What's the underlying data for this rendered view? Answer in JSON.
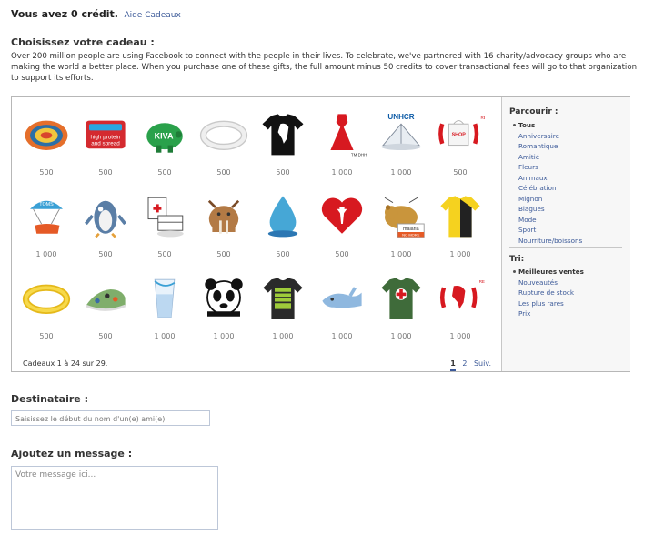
{
  "header": {
    "credits_text": "Vous avez 0 crédit.",
    "help_link": "Aide Cadeaux"
  },
  "choose": {
    "title": "Choisissez votre cadeau :",
    "intro": "Over 200 million people are using Facebook to connect with the people in their lives. To celebrate, we've partnered with 16 charity/advocacy groups who are making the world a better place. When you purchase one of these gifts, the full amount minus 50 credits to cover transactional fees will go to that organization to support its efforts."
  },
  "gifts": [
    {
      "name": "woven-disc-gift",
      "price": "500"
    },
    {
      "name": "unicef-sign-gift",
      "price": "500",
      "text": "high protein\nand spread"
    },
    {
      "name": "kiva-piggy-bank-gift",
      "price": "500",
      "text": "KIVA"
    },
    {
      "name": "white-bracelet-gift",
      "price": "500"
    },
    {
      "name": "africa-tshirt-gift",
      "price": "500"
    },
    {
      "name": "red-dress-gift",
      "price": "1 000",
      "text": "TM DHHS"
    },
    {
      "name": "unhcr-tent-gift",
      "price": "1 000",
      "text": "UNHCR"
    },
    {
      "name": "red-shop-bag-gift",
      "price": "500",
      "text": "SHOP\nRED"
    },
    {
      "name": "toms-shoe-parachute-gift",
      "price": "1 000",
      "text": "TOMS"
    },
    {
      "name": "penguin-gift",
      "price": "500"
    },
    {
      "name": "red-cross-kit-gift",
      "price": "500"
    },
    {
      "name": "walrus-gift",
      "price": "500"
    },
    {
      "name": "water-drop-gift",
      "price": "500"
    },
    {
      "name": "heart-torch-gift",
      "price": "500"
    },
    {
      "name": "malaria-bear-gift",
      "price": "1 000",
      "text": "malaria\nNO MORE"
    },
    {
      "name": "jersey-gift",
      "price": "1 000"
    },
    {
      "name": "yellow-bracelet-gift",
      "price": "500"
    },
    {
      "name": "patterned-shoe-gift",
      "price": "500"
    },
    {
      "name": "water-glass-gift",
      "price": "1 000"
    },
    {
      "name": "panda-gift",
      "price": "1 000"
    },
    {
      "name": "green-graphic-tshirt-gift",
      "price": "1 000"
    },
    {
      "name": "whale-gift",
      "price": "1 000"
    },
    {
      "name": "red-cross-tshirt-gift",
      "price": "1 000"
    },
    {
      "name": "red-africa-gift",
      "price": "1 000",
      "text": "RED"
    }
  ],
  "gift_grid": {
    "count_text": "Cadeaux 1 à 24 sur 29.",
    "pages": [
      "1",
      "2"
    ],
    "next": "Suiv."
  },
  "browse": {
    "title": "Parcourir :",
    "items": [
      "Tous",
      "Anniversaire",
      "Romantique",
      "Amitié",
      "Fleurs",
      "Animaux",
      "Célébration",
      "Mignon",
      "Blagues",
      "Mode",
      "Sport",
      "Nourriture/boissons"
    ]
  },
  "sort": {
    "title": "Tri:",
    "items": [
      "Meilleures ventes",
      "Nouveautés",
      "Rupture de stock",
      "Les plus rares",
      "Prix"
    ]
  },
  "recipient": {
    "title": "Destinataire :",
    "placeholder": "Saisissez le début du nom d'un(e) ami(e)"
  },
  "message": {
    "title": "Ajoutez un message :",
    "placeholder": "Votre message ici..."
  }
}
